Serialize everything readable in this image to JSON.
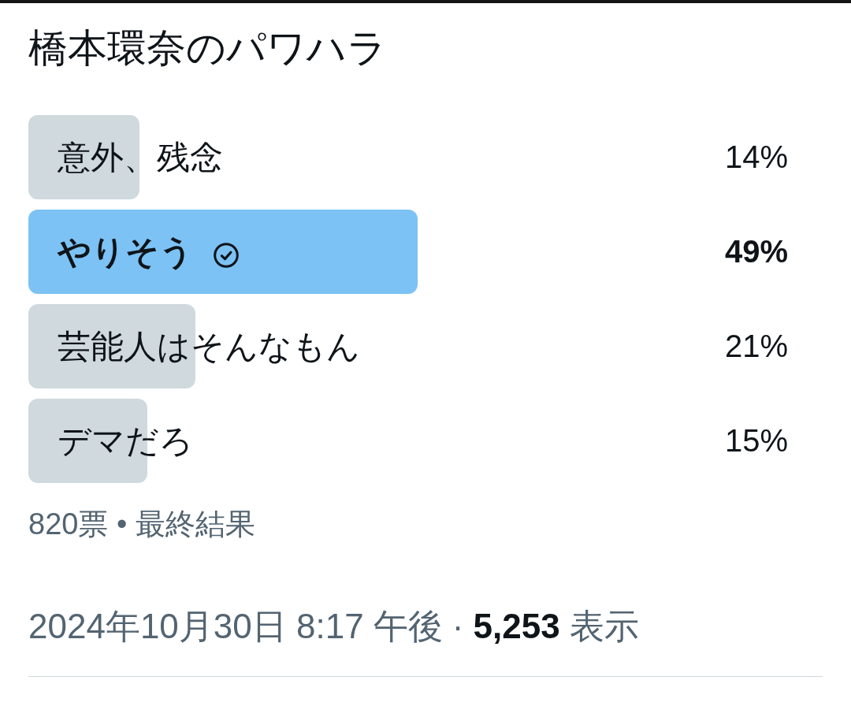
{
  "question": "橋本環奈のパワハラ",
  "options": [
    {
      "label": "意外、残念",
      "percentage": "14%",
      "level": 0.14,
      "winner": false,
      "voted": false
    },
    {
      "label": "やりそう",
      "percentage": "49%",
      "level": 0.49,
      "winner": true,
      "voted": true
    },
    {
      "label": "芸能人はそんなもん",
      "percentage": "21%",
      "level": 0.21,
      "winner": false,
      "voted": false
    },
    {
      "label": "デマだろ",
      "percentage": "15%",
      "level": 0.15,
      "winner": false,
      "voted": false
    }
  ],
  "summary": "820票 • 最終結果",
  "meta": {
    "posted_at": "2024年10月30日 8:17 午後",
    "separator": "·",
    "views": "**5,253** 表示"
  }
}
